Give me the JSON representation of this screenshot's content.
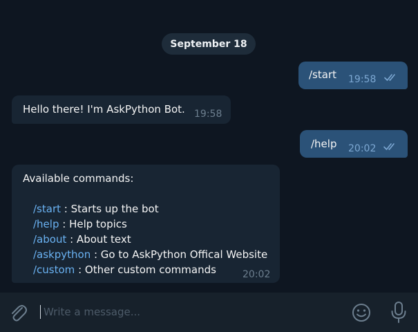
{
  "chat": {
    "date": "September 18",
    "messages": [
      {
        "text": "/start",
        "time": "19:58"
      },
      {
        "text": "Hello there! I'm AskPython Bot.",
        "time": "19:58"
      },
      {
        "text": "/help",
        "time": "20:02"
      },
      {
        "heading": "Available commands:",
        "commands": [
          {
            "cmd": "/start",
            "desc": " : Starts up the bot"
          },
          {
            "cmd": "/help",
            "desc": " : Help topics"
          },
          {
            "cmd": "/about",
            "desc": " : About text"
          },
          {
            "cmd": "/askpython",
            "desc": " : Go to AskPython Offical Website"
          },
          {
            "cmd": "/custom",
            "desc": " : Other custom commands"
          }
        ],
        "time": "20:02"
      }
    ]
  },
  "input": {
    "placeholder": "Write a message..."
  },
  "icons": {
    "attach": "paperclip-icon",
    "emoji": "emoji-icon",
    "voice": "microphone-icon",
    "read": "double-check-icon"
  },
  "colors": {
    "background": "#0e1621",
    "incoming_bubble": "#182533",
    "outgoing_bubble": "#2b5278",
    "link": "#6ab2f2",
    "input_bar": "#17212b"
  }
}
